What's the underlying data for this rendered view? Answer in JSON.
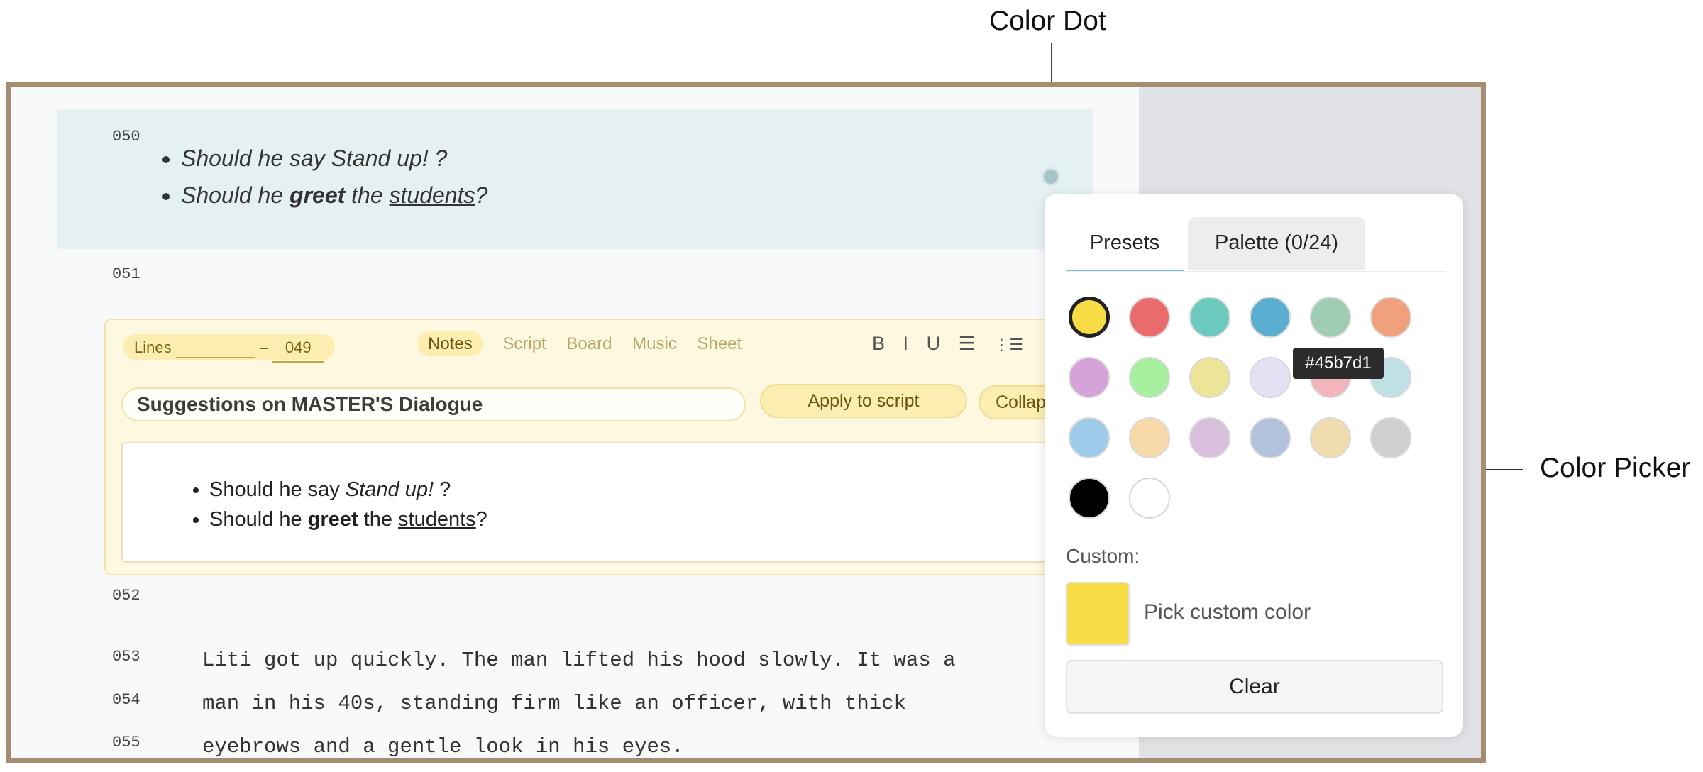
{
  "annotations": {
    "color_dot": "Color Dot",
    "color_picker": "Color Picker"
  },
  "script": {
    "line_numbers": {
      "l050": "050",
      "l051": "051",
      "l052": "052",
      "l053": "053",
      "l054": "054",
      "l055": "055"
    },
    "block_050": {
      "bullet1": "Should he say Stand up! ?",
      "bullet2_a": "Should he ",
      "bullet2_b": "greet",
      "bullet2_c": " the ",
      "bullet2_d": "students",
      "bullet2_e": "?"
    },
    "lines_053_055": [
      "Liti got up quickly. The man lifted his hood slowly. It was a",
      "man in his 40s, standing firm like an officer, with thick",
      "eyebrows and a gentle look in his eyes."
    ]
  },
  "note": {
    "lines_label": "Lines",
    "lines_dash": "–",
    "lines_to": "049",
    "tabs": {
      "notes": "Notes",
      "script": "Script",
      "board": "Board",
      "music": "Music",
      "sheet": "Sheet"
    },
    "format": {
      "bold": "B",
      "italic": "I",
      "underline": "U",
      "bullet_list": "☰",
      "numbered_list": "⋮☰"
    },
    "title_value": "Suggestions on MASTER'S Dialogue",
    "apply_label": "Apply to script",
    "collapse_label": "Collapse",
    "editor": {
      "b1_a": "Should he say ",
      "b1_b": "Stand up!",
      "b1_c": " ?",
      "b2_a": "Should he ",
      "b2_b": "greet",
      "b2_c": " the ",
      "b2_d": "students",
      "b2_e": "?"
    }
  },
  "picker": {
    "tab_presets": "Presets",
    "tab_palette": "Palette (0/24)",
    "swatches": [
      "#f8dc45",
      "#ea6b6b",
      "#6cc9be",
      "#5aaed0",
      "#9fcdb3",
      "#f0a07c",
      "#d5a2d9",
      "#a6f0a0",
      "#ece497",
      "#e4e1f4",
      "#f3b5bd",
      "#bfe1e6",
      "#9fcde9",
      "#f8d9a9",
      "#d8c0dc",
      "#b3c2dc",
      "#f0dcae",
      "#d0d0d0",
      "#000000",
      "#ffffff"
    ],
    "tooltip": "#45b7d1",
    "custom_label": "Custom:",
    "custom_color": "#f8dc45",
    "pick_custom_label": "Pick custom color",
    "clear_label": "Clear"
  }
}
